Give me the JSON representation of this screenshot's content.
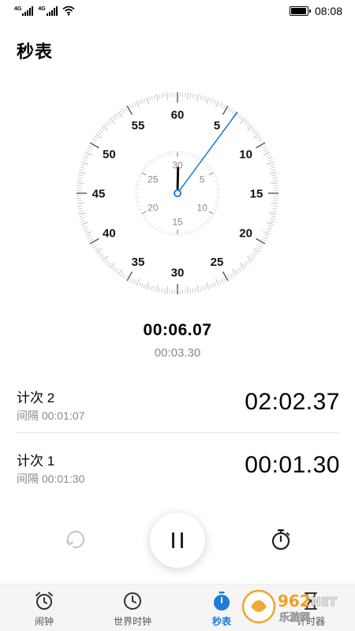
{
  "status_bar": {
    "signal_1_label": "4G",
    "signal_2_label": "4G",
    "time": "08:08",
    "battery_level": 0.95,
    "icons": [
      "signal-icon",
      "signal-icon",
      "wifi-icon",
      "battery-icon"
    ]
  },
  "page": {
    "title": "秒表"
  },
  "dial": {
    "outer_labels": [
      "60",
      "5",
      "10",
      "15",
      "20",
      "25",
      "30",
      "35",
      "40",
      "45",
      "50",
      "55"
    ],
    "inner_labels": [
      "30",
      "5",
      "10",
      "15",
      "20",
      "25"
    ],
    "outer_hand_seconds": 6.07,
    "inner_hand_minutes": 0.1,
    "colors": {
      "hand": "#1e7bd8",
      "tick": "#bdbdbd",
      "label": "#111111",
      "inner_label": "#8a8a8a"
    }
  },
  "readout": {
    "total": "00:06.07",
    "current_lap": "00:03.30"
  },
  "laps": [
    {
      "title": "计次 2",
      "interval": "间隔 00:01:07",
      "time": "02:02.37"
    },
    {
      "title": "计次 1",
      "interval": "间隔 00:01:30",
      "time": "00:01.30"
    }
  ],
  "controls": {
    "icons": [
      "reset-icon",
      "pause-icon",
      "lap-timer-icon"
    ]
  },
  "tabs": [
    {
      "label": "闹钟",
      "icon": "alarm-clock-icon",
      "active": false
    },
    {
      "label": "世界时钟",
      "icon": "world-clock-icon",
      "active": false
    },
    {
      "label": "秒表",
      "icon": "stopwatch-icon",
      "active": true
    },
    {
      "label": "计时器",
      "icon": "timer-icon",
      "active": false
    }
  ],
  "watermark": {
    "brand": "962",
    "suffix": "NET",
    "subtitle": "乐游网"
  },
  "colors": {
    "accent": "#1e7bd8",
    "text_secondary": "#8a8a8a",
    "tabbar_bg": "#f5f5f5"
  }
}
